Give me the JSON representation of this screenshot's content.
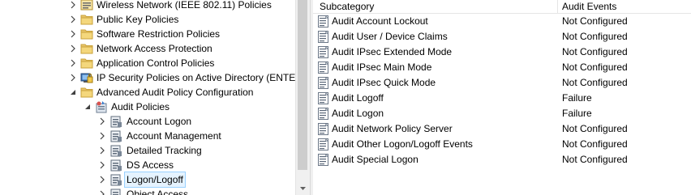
{
  "tree": {
    "items": [
      {
        "label": "Wireless Network (IEEE 802.11) Policies",
        "icon": "policy-settings-icon",
        "expanded": false
      },
      {
        "label": "Public Key Policies",
        "icon": "folder-icon",
        "expanded": false
      },
      {
        "label": "Software Restriction Policies",
        "icon": "folder-icon",
        "expanded": false
      },
      {
        "label": "Network Access Protection",
        "icon": "folder-icon",
        "expanded": false
      },
      {
        "label": "Application Control Policies",
        "icon": "folder-icon",
        "expanded": false
      },
      {
        "label": "IP Security Policies on Active Directory (ENTER",
        "icon": "ip-security-icon",
        "expanded": false
      },
      {
        "label": "Advanced Audit Policy Configuration",
        "icon": "folder-icon",
        "expanded": true
      },
      {
        "label": "Audit Policies",
        "icon": "audit-policies-icon",
        "expanded": true
      },
      {
        "label": "Account Logon",
        "icon": "audit-category-icon",
        "expanded": false
      },
      {
        "label": "Account Management",
        "icon": "audit-category-icon",
        "expanded": false
      },
      {
        "label": "Detailed Tracking",
        "icon": "audit-category-icon",
        "expanded": false
      },
      {
        "label": "DS Access",
        "icon": "audit-category-icon",
        "expanded": false
      },
      {
        "label": "Logon/Logoff",
        "icon": "audit-category-icon",
        "expanded": false,
        "selected": true
      },
      {
        "label": "Object Access",
        "icon": "audit-category-icon",
        "expanded": false
      }
    ]
  },
  "list": {
    "columns": [
      "Subcategory",
      "Audit Events"
    ],
    "rows": [
      {
        "subcategory": "Audit Account Lockout",
        "events": "Not Configured"
      },
      {
        "subcategory": "Audit User / Device Claims",
        "events": "Not Configured"
      },
      {
        "subcategory": "Audit IPsec Extended Mode",
        "events": "Not Configured"
      },
      {
        "subcategory": "Audit IPsec Main Mode",
        "events": "Not Configured"
      },
      {
        "subcategory": "Audit IPsec Quick Mode",
        "events": "Not Configured"
      },
      {
        "subcategory": "Audit Logoff",
        "events": "Failure"
      },
      {
        "subcategory": "Audit Logon",
        "events": "Failure"
      },
      {
        "subcategory": "Audit Network Policy Server",
        "events": "Not Configured"
      },
      {
        "subcategory": "Audit Other Logon/Logoff Events",
        "events": "Not Configured"
      },
      {
        "subcategory": "Audit Special Logon",
        "events": "Not Configured"
      }
    ]
  },
  "colors": {
    "folder": "#e8c46a",
    "selection_bg": "#e5f3ff",
    "selection_border": "#99d1ff"
  }
}
